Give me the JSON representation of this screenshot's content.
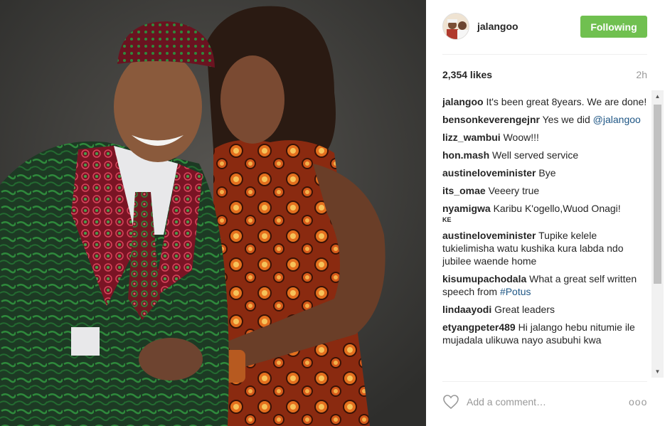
{
  "post": {
    "image_alt": "Photo of a smiling man in a patterned hat and suit beside a woman in an orange patterned dress"
  },
  "header": {
    "username": "jalangoo",
    "follow_label": "Following",
    "follow_color": "#70c050"
  },
  "stats": {
    "likes": "2,354 likes",
    "time": "2h"
  },
  "comments": [
    {
      "user": "jalangoo",
      "text": "It's been great 8years. We are done!"
    },
    {
      "user": "bensonkeverengejnr",
      "text": "Yes we did ",
      "mention": "@jalangoo"
    },
    {
      "user": "lizz_wambui",
      "text": "Woow!!!"
    },
    {
      "user": "hon.mash",
      "text": "Well served service"
    },
    {
      "user": "austineloveminister",
      "text": "Bye"
    },
    {
      "user": "its_omae",
      "text": "Veeery true"
    },
    {
      "user": "nyamigwa",
      "text": "Karibu K'ogello,Wuod Onagi!",
      "badge": "KE"
    },
    {
      "user": "austineloveminister",
      "text": "Tupike kelele tukielimisha watu kushika kura labda ndo jubilee waende home"
    },
    {
      "user": "kisumupachodala",
      "text": "What a great self written speech from ",
      "hashtag": "#Potus"
    },
    {
      "user": "lindaayodi",
      "text": "Great leaders"
    },
    {
      "user": "etyangpeter489",
      "text": "Hi jalango hebu nitumie ile mujadala ulikuwa nayo asubuhi kwa"
    }
  ],
  "comment_box": {
    "placeholder": "Add a comment…",
    "more_label": "ooo"
  },
  "icons": {
    "heart": "heart-icon",
    "more": "more-options-icon",
    "scroll_up": "scroll-up-icon",
    "scroll_down": "scroll-down-icon"
  },
  "colors": {
    "link": "#1e5685",
    "muted": "#999999",
    "divider": "#efefef"
  }
}
